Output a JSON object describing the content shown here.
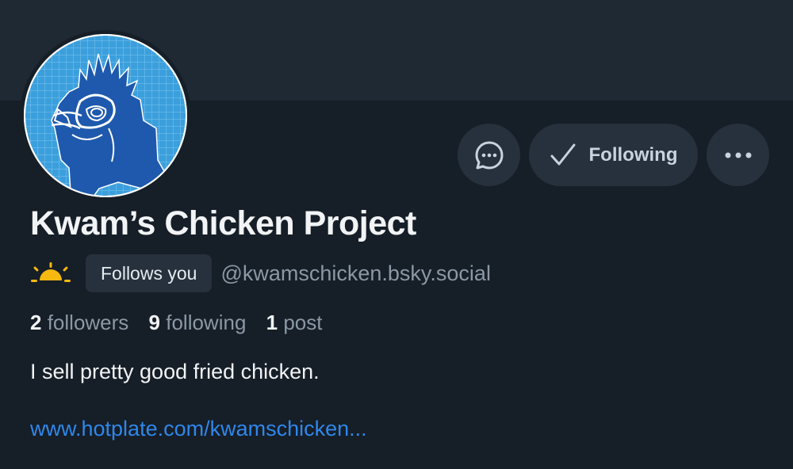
{
  "profile": {
    "display_name": "Kwam’s Chicken Project",
    "follows_you_label": "Follows you",
    "handle": "@kwamschicken.bsky.social",
    "bio": "I sell pretty good fried chicken.",
    "link": "www.hotplate.com/kwamschicken..."
  },
  "stats": {
    "followers_count": "2",
    "followers_label": "followers",
    "following_count": "9",
    "following_label": "following",
    "posts_count": "1",
    "posts_label": "post"
  },
  "actions": {
    "following_label": "Following",
    "message_icon": "chat-bubble-icon",
    "more_icon": "ellipsis-icon"
  },
  "colors": {
    "background": "#161e27",
    "banner": "#1f2934",
    "button": "#26313d",
    "link": "#2f87ea",
    "muted": "#8b98a5",
    "sun": "#f5b90f"
  }
}
